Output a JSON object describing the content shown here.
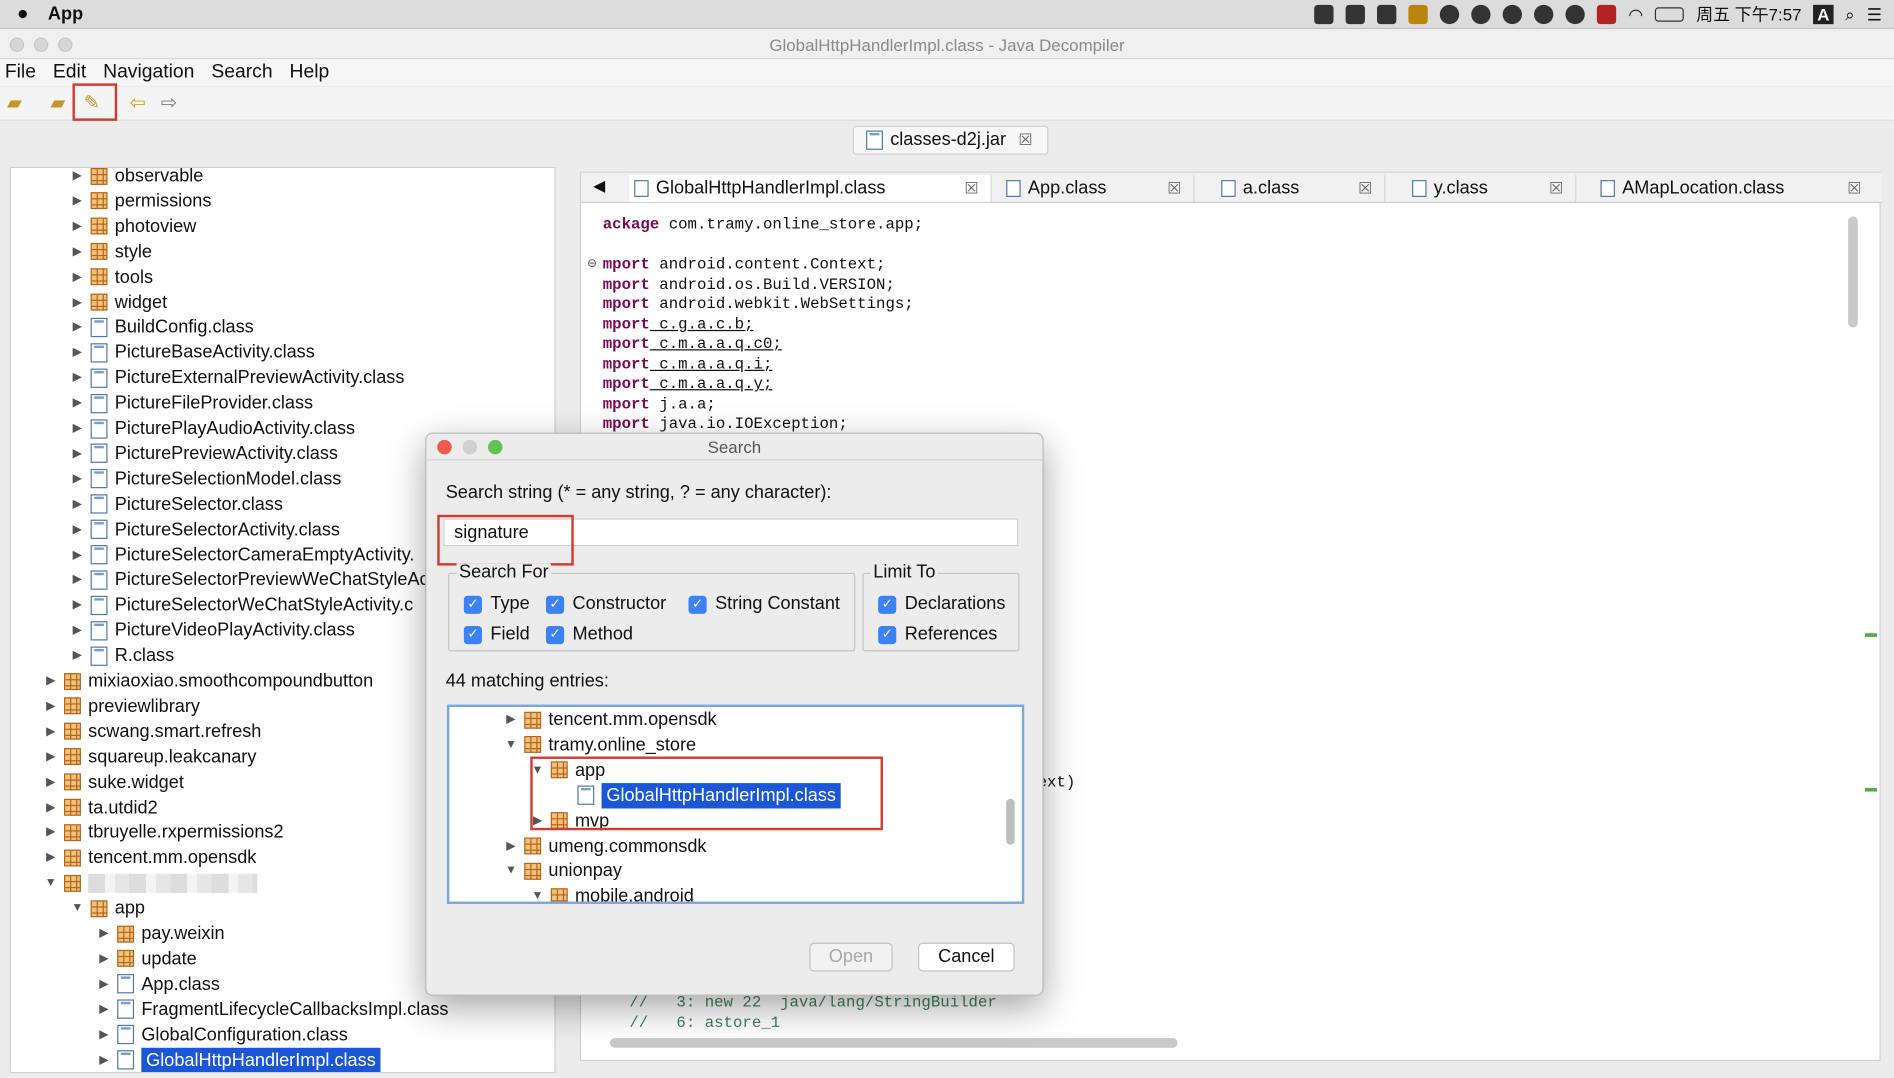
{
  "mac_menubar": {
    "app_name": "App",
    "clock": "周五 下午7:57",
    "input_method": "A"
  },
  "window": {
    "title": "GlobalHttpHandlerImpl.class - Java Decompiler"
  },
  "menu": [
    "File",
    "Edit",
    "Navigation",
    "Search",
    "Help"
  ],
  "jar_tab": {
    "label": "classes-d2j.jar"
  },
  "tree": [
    {
      "label": "observable",
      "type": "package",
      "indent": 1,
      "arrow": "right"
    },
    {
      "label": "permissions",
      "type": "package",
      "indent": 1,
      "arrow": "right"
    },
    {
      "label": "photoview",
      "type": "package",
      "indent": 1,
      "arrow": "right"
    },
    {
      "label": "style",
      "type": "package",
      "indent": 1,
      "arrow": "right"
    },
    {
      "label": "tools",
      "type": "package",
      "indent": 1,
      "arrow": "right"
    },
    {
      "label": "widget",
      "type": "package",
      "indent": 1,
      "arrow": "right"
    },
    {
      "label": "BuildConfig.class",
      "type": "class",
      "indent": 1,
      "arrow": "right"
    },
    {
      "label": "PictureBaseActivity.class",
      "type": "class",
      "indent": 1,
      "arrow": "right"
    },
    {
      "label": "PictureExternalPreviewActivity.class",
      "type": "class",
      "indent": 1,
      "arrow": "right"
    },
    {
      "label": "PictureFileProvider.class",
      "type": "class",
      "indent": 1,
      "arrow": "right"
    },
    {
      "label": "PicturePlayAudioActivity.class",
      "type": "class",
      "indent": 1,
      "arrow": "right"
    },
    {
      "label": "PicturePreviewActivity.class",
      "type": "class",
      "indent": 1,
      "arrow": "right"
    },
    {
      "label": "PictureSelectionModel.class",
      "type": "class",
      "indent": 1,
      "arrow": "right"
    },
    {
      "label": "PictureSelector.class",
      "type": "class",
      "indent": 1,
      "arrow": "right"
    },
    {
      "label": "PictureSelectorActivity.class",
      "type": "class",
      "indent": 1,
      "arrow": "right"
    },
    {
      "label": "PictureSelectorCameraEmptyActivity.",
      "type": "class",
      "indent": 1,
      "arrow": "right"
    },
    {
      "label": "PictureSelectorPreviewWeChatStyleAc",
      "type": "class",
      "indent": 1,
      "arrow": "right"
    },
    {
      "label": "PictureSelectorWeChatStyleActivity.c",
      "type": "class",
      "indent": 1,
      "arrow": "right"
    },
    {
      "label": "PictureVideoPlayActivity.class",
      "type": "class",
      "indent": 1,
      "arrow": "right"
    },
    {
      "label": "R.class",
      "type": "class",
      "indent": 1,
      "arrow": "right"
    },
    {
      "label": "mixiaoxiao.smoothcompoundbutton",
      "type": "package",
      "indent": 0,
      "arrow": "right"
    },
    {
      "label": "previewlibrary",
      "type": "package",
      "indent": 0,
      "arrow": "right"
    },
    {
      "label": "scwang.smart.refresh",
      "type": "package",
      "indent": 0,
      "arrow": "right"
    },
    {
      "label": "squareup.leakcanary",
      "type": "package",
      "indent": 0,
      "arrow": "right"
    },
    {
      "label": "suke.widget",
      "type": "package",
      "indent": 0,
      "arrow": "right"
    },
    {
      "label": "ta.utdid2",
      "type": "package",
      "indent": 0,
      "arrow": "right"
    },
    {
      "label": "tbruyelle.rxpermissions2",
      "type": "package",
      "indent": 0,
      "arrow": "right"
    },
    {
      "label": "tencent.mm.opensdk",
      "type": "package",
      "indent": 0,
      "arrow": "right"
    },
    {
      "label": "",
      "type": "package-blurred",
      "indent": 0,
      "arrow": "down"
    },
    {
      "label": "app",
      "type": "package",
      "indent": 1,
      "arrow": "down"
    },
    {
      "label": "pay.weixin",
      "type": "package",
      "indent": 2,
      "arrow": "right"
    },
    {
      "label": "update",
      "type": "package",
      "indent": 2,
      "arrow": "right"
    },
    {
      "label": "App.class",
      "type": "class",
      "indent": 2,
      "arrow": "right"
    },
    {
      "label": "FragmentLifecycleCallbacksImpl.class",
      "type": "class",
      "indent": 2,
      "arrow": "right"
    },
    {
      "label": "GlobalConfiguration.class",
      "type": "class",
      "indent": 2,
      "arrow": "right"
    },
    {
      "label": "GlobalHttpHandlerImpl.class",
      "type": "class",
      "indent": 2,
      "arrow": "right",
      "selected": true
    }
  ],
  "editor_tabs": [
    {
      "label": "GlobalHttpHandlerImpl.class",
      "active": true
    },
    {
      "label": "App.class"
    },
    {
      "label": "a.class"
    },
    {
      "label": "y.class"
    },
    {
      "label": "AMapLocation.class"
    }
  ],
  "code_lines": [
    [
      "ackage",
      " com.tramy.online_store.app;"
    ],
    [
      "",
      ""
    ],
    [
      "mport",
      " android.content.Context;"
    ],
    [
      "mport",
      " android.os.Build.VERSION;"
    ],
    [
      "mport",
      " android.webkit.WebSettings;"
    ],
    [
      "mport",
      " c.g.a.c.b;"
    ],
    [
      "mport",
      " c.m.a.a.q.c0;"
    ],
    [
      "mport",
      " c.m.a.a.q.i;"
    ],
    [
      "mport",
      " c.m.a.a.q.y;"
    ],
    [
      "mport",
      " j.a.a;"
    ],
    [
      "mport",
      " java.io.IOException;"
    ]
  ],
  "code_fragment": "ext)",
  "code_comments": [
    "//   3: new 22  java/lang/StringBuilder",
    "//   6: astore_1"
  ],
  "dialog": {
    "title": "Search",
    "prompt": "Search string (* = any string, ? = any character):",
    "value": "signature",
    "search_for_label": "Search For",
    "search_for": [
      {
        "label": "Type",
        "checked": true
      },
      {
        "label": "Constructor",
        "checked": true
      },
      {
        "label": "String Constant",
        "checked": true
      },
      {
        "label": "Field",
        "checked": true
      },
      {
        "label": "Method",
        "checked": true
      }
    ],
    "limit_to_label": "Limit To",
    "limit_to": [
      {
        "label": "Declarations",
        "checked": true
      },
      {
        "label": "References",
        "checked": true
      }
    ],
    "matches": "44 matching entries:",
    "results": [
      {
        "label": "tencent.mm.opensdk",
        "type": "package",
        "indent": 0,
        "arrow": "right"
      },
      {
        "label": "tramy.online_store",
        "type": "package",
        "indent": 0,
        "arrow": "down"
      },
      {
        "label": "app",
        "type": "package",
        "indent": 1,
        "arrow": "down"
      },
      {
        "label": "GlobalHttpHandlerImpl.class",
        "type": "class",
        "indent": 2,
        "arrow": "",
        "selected": true
      },
      {
        "label": "mvp",
        "type": "package",
        "indent": 1,
        "arrow": "right"
      },
      {
        "label": "umeng.commonsdk",
        "type": "package",
        "indent": 0,
        "arrow": "right"
      },
      {
        "label": "unionpay",
        "type": "package",
        "indent": 0,
        "arrow": "down"
      },
      {
        "label": "mobile.android",
        "type": "package",
        "indent": 1,
        "arrow": "down"
      }
    ],
    "open_label": "Open",
    "cancel_label": "Cancel"
  },
  "colors": {
    "selection": "#1a57d8",
    "highlight_box": "#d43a32",
    "checkbox": "#3b82f6"
  }
}
